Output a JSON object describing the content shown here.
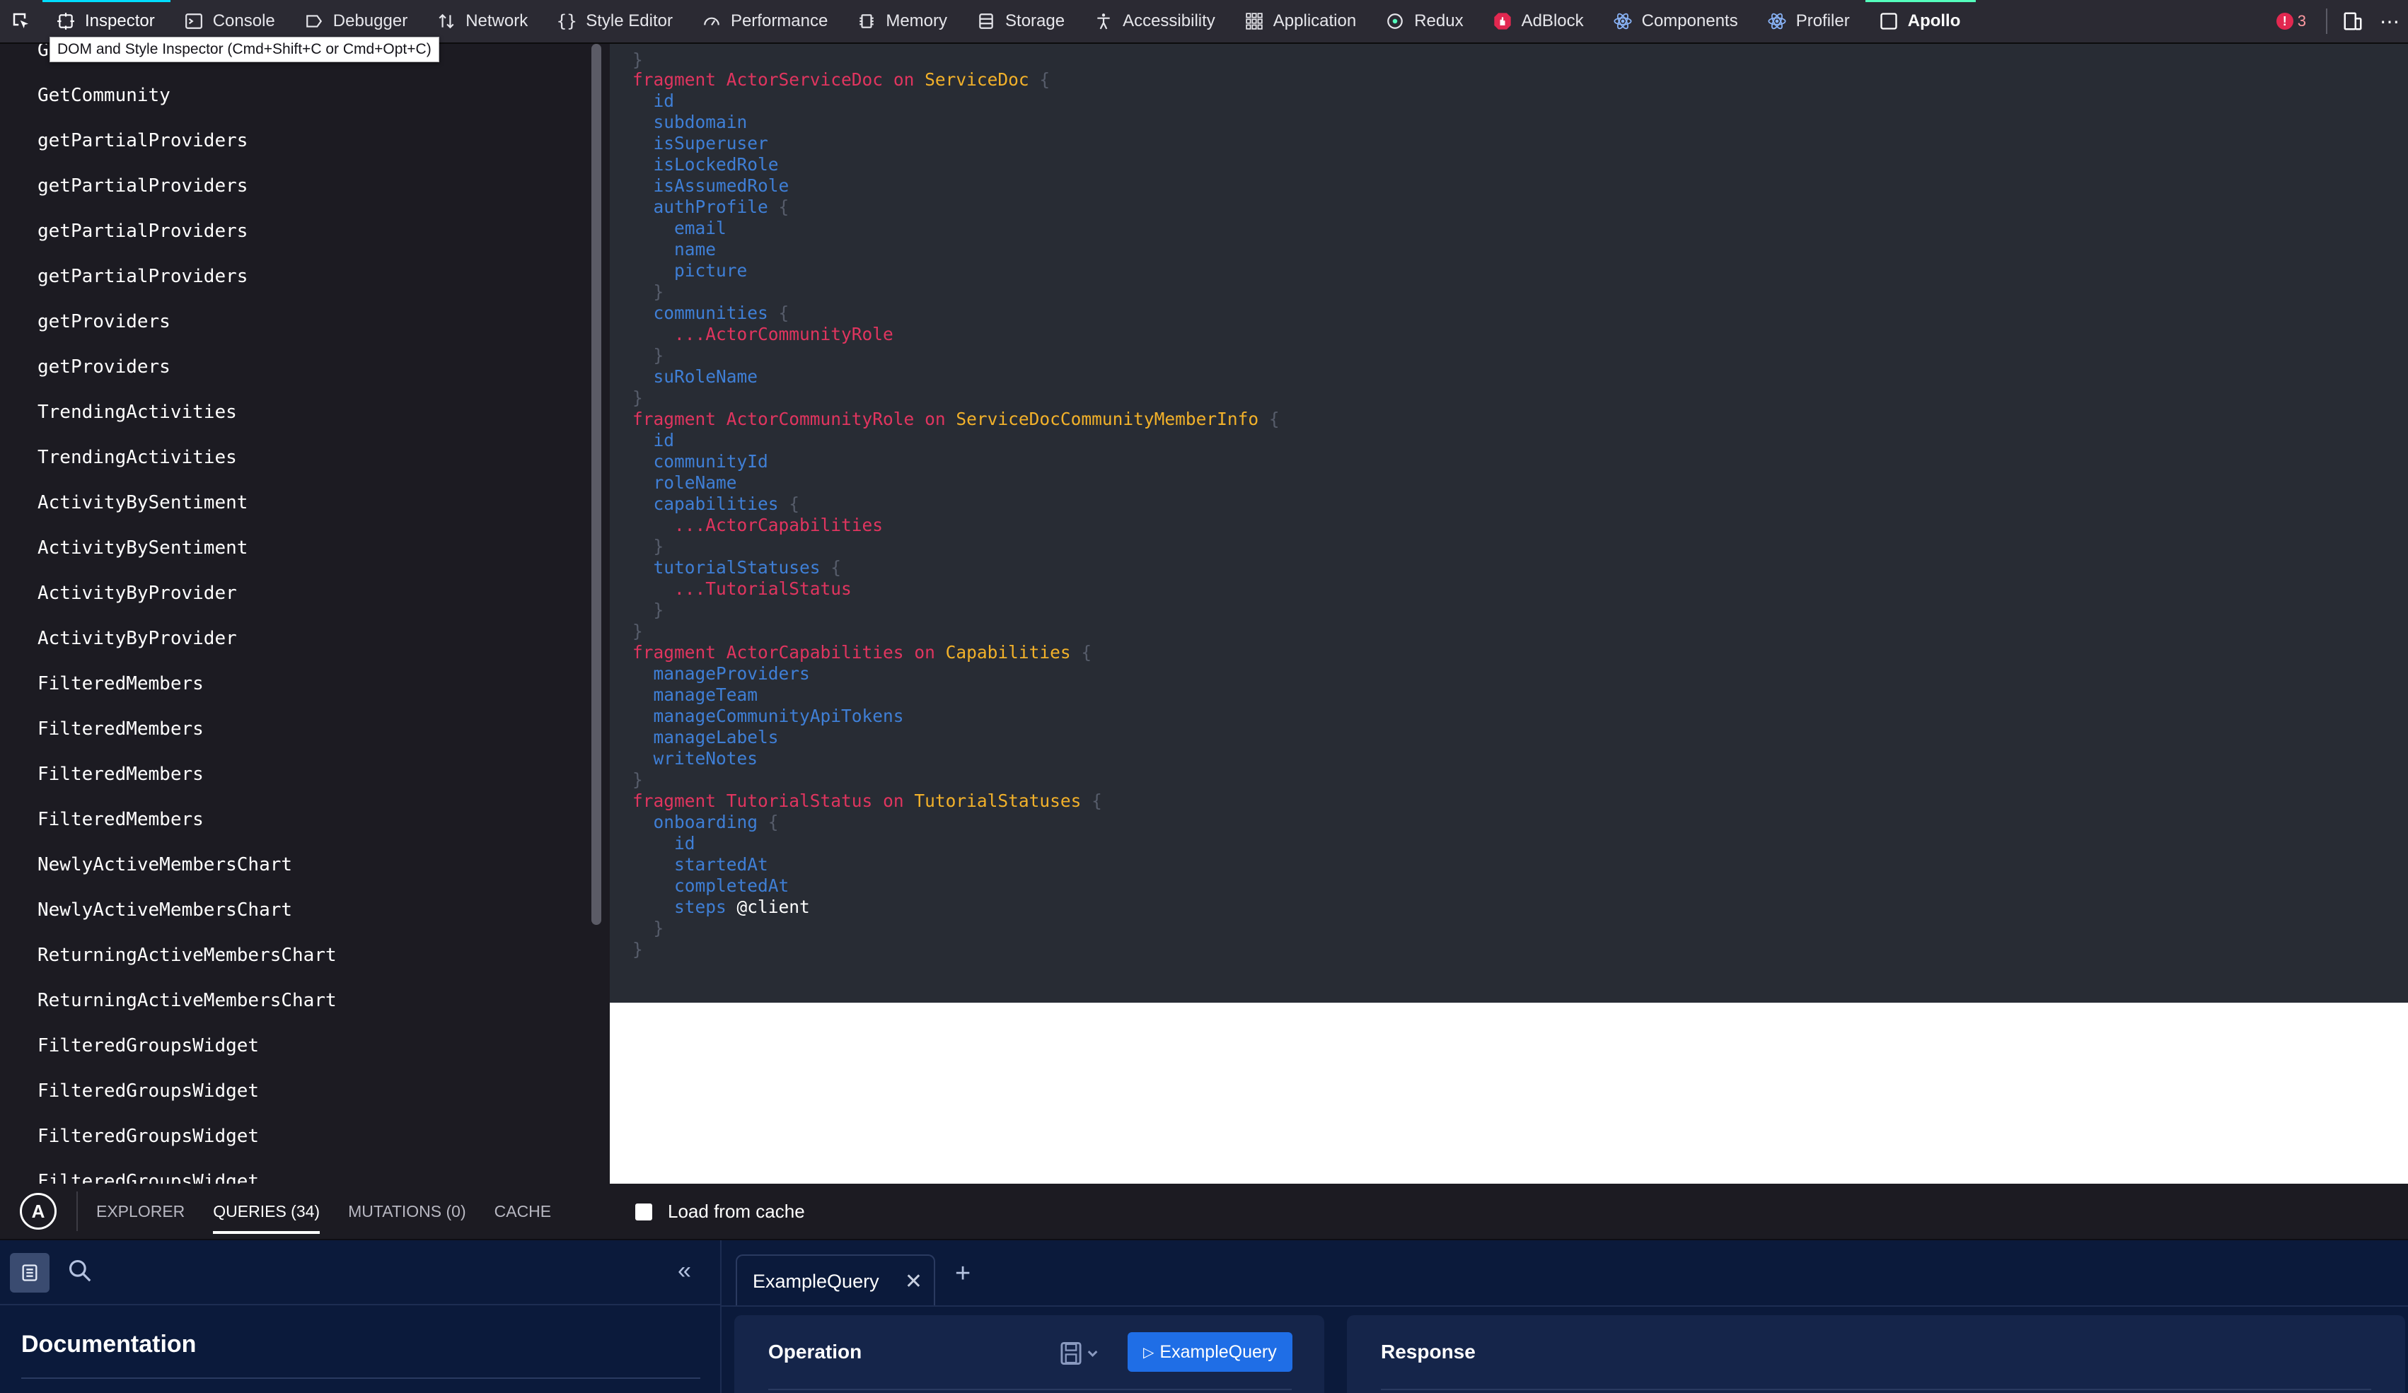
{
  "toolbar": {
    "tabs": [
      {
        "label": "Inspector",
        "icon": "inspector-icon"
      },
      {
        "label": "Console",
        "icon": "console-icon"
      },
      {
        "label": "Debugger",
        "icon": "debugger-icon"
      },
      {
        "label": "Network",
        "icon": "network-icon"
      },
      {
        "label": "Style Editor",
        "icon": "braces-icon"
      },
      {
        "label": "Performance",
        "icon": "gauge-icon"
      },
      {
        "label": "Memory",
        "icon": "memory-icon"
      },
      {
        "label": "Storage",
        "icon": "storage-icon"
      },
      {
        "label": "Accessibility",
        "icon": "accessibility-icon"
      },
      {
        "label": "Application",
        "icon": "grid-icon"
      },
      {
        "label": "Redux",
        "icon": "redux-icon"
      },
      {
        "label": "AdBlock",
        "icon": "adblock-icon"
      },
      {
        "label": "Components",
        "icon": "react-icon"
      },
      {
        "label": "Profiler",
        "icon": "react-icon"
      },
      {
        "label": "Apollo",
        "icon": "apollo-square-icon"
      }
    ],
    "error_count": "3",
    "tooltip": "DOM and Style Inspector (Cmd+Shift+C or Cmd+Opt+C)"
  },
  "queries": [
    "GetCommunity",
    "GetCommunity",
    "getPartialProviders",
    "getPartialProviders",
    "getPartialProviders",
    "getPartialProviders",
    "getProviders",
    "getProviders",
    "TrendingActivities",
    "TrendingActivities",
    "ActivityBySentiment",
    "ActivityBySentiment",
    "ActivityByProvider",
    "ActivityByProvider",
    "FilteredMembers",
    "FilteredMembers",
    "FilteredMembers",
    "FilteredMembers",
    "NewlyActiveMembersChart",
    "NewlyActiveMembersChart",
    "ReturningActiveMembersChart",
    "ReturningActiveMembersChart",
    "FilteredGroupsWidget",
    "FilteredGroupsWidget",
    "FilteredGroupsWidget",
    "FilteredGroupsWidget"
  ],
  "code": {
    "fragments": [
      {
        "keyword": "fragment",
        "name": "ActorServiceDoc",
        "on": "on",
        "type": "ServiceDoc"
      },
      {
        "keyword": "fragment",
        "name": "ActorCommunityRole",
        "on": "on",
        "type": "ServiceDocCommunityMemberInfo"
      },
      {
        "keyword": "fragment",
        "name": "ActorCapabilities",
        "on": "on",
        "type": "Capabilities"
      },
      {
        "keyword": "fragment",
        "name": "TutorialStatus",
        "on": "on",
        "type": "TutorialStatuses"
      }
    ],
    "fields": {
      "id": "id",
      "subdomain": "subdomain",
      "isSuperuser": "isSuperuser",
      "isLockedRole": "isLockedRole",
      "isAssumedRole": "isAssumedRole",
      "authProfile": "authProfile",
      "email": "email",
      "name": "name",
      "picture": "picture",
      "communities": "communities",
      "spread_role": "...ActorCommunityRole",
      "suRoleName": "suRoleName",
      "communityId": "communityId",
      "roleName": "roleName",
      "capabilities": "capabilities",
      "spread_caps": "...ActorCapabilities",
      "tutorialStatuses": "tutorialStatuses",
      "spread_tut": "...TutorialStatus",
      "manageProviders": "manageProviders",
      "manageTeam": "manageTeam",
      "manageCommunityApiTokens": "manageCommunityApiTokens",
      "manageLabels": "manageLabels",
      "writeNotes": "writeNotes",
      "onboarding": "onboarding",
      "startedAt": "startedAt",
      "completedAt": "completedAt",
      "steps": "steps",
      "client_directive": "@client"
    }
  },
  "apollo_bar": {
    "tabs": [
      "EXPLORER",
      "QUERIES (34)",
      "MUTATIONS (0)",
      "CACHE"
    ],
    "active_tab": "QUERIES (34)",
    "load_from_cache": "Load from cache"
  },
  "explorer": {
    "doc_title": "Documentation",
    "tab_label": "ExampleQuery",
    "operation_title": "Operation",
    "run_button": "ExampleQuery",
    "response_title": "Response"
  }
}
